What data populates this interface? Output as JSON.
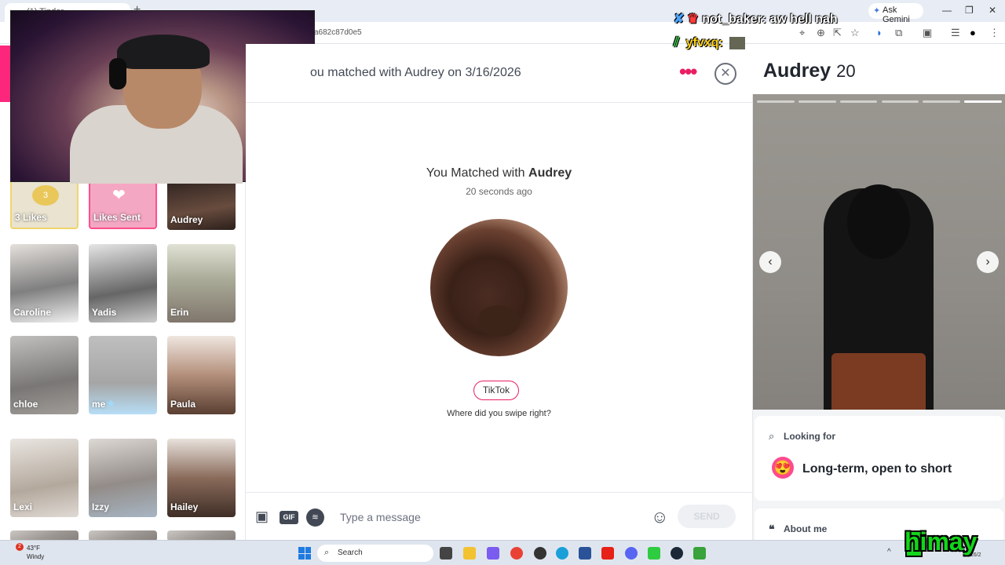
{
  "browser": {
    "tab_title": "(1) Tinder",
    "address": "a682c87d0e5",
    "ask_gemini": "Ask Gemini"
  },
  "left_panel": {
    "likes_count": "3",
    "tiles": [
      {
        "label": "3 Likes"
      },
      {
        "label": "Likes Sent"
      },
      {
        "label": "Audrey"
      },
      {
        "label": "Caroline"
      },
      {
        "label": "Yadis"
      },
      {
        "label": "Erin"
      },
      {
        "label": "chloe"
      },
      {
        "label": "me"
      },
      {
        "label": "Paula"
      },
      {
        "label": "Lexi"
      },
      {
        "label": "Izzy"
      },
      {
        "label": "Hailey"
      }
    ]
  },
  "chat": {
    "header_text": "ou matched with Audrey on 3/16/2026",
    "matched_prefix": "You Matched with ",
    "matched_name": "Audrey",
    "matched_time": "20 seconds ago",
    "platform_pill": "TikTok",
    "swipe_question": "Where did you swipe right?",
    "input_placeholder": "Type a message",
    "send_label": "SEND",
    "gif_label": "GIF"
  },
  "profile": {
    "name": "Audrey",
    "age": "20",
    "looking_for_label": "Looking for",
    "looking_for_value": "Long-term, open to short",
    "looking_for_emoji": "😍",
    "about_label": "About me",
    "photo_count": 6,
    "active_photo": 6
  },
  "stream_chat": [
    {
      "user": "not_baker:",
      "text": "aw hell nah"
    },
    {
      "user": "yfvxq:",
      "text": ""
    }
  ],
  "taskbar": {
    "weather_badge": "2",
    "temperature": "43°F",
    "weather": "Windy",
    "search_label": "Search",
    "date": "3/16/2",
    "streamer": "himay"
  },
  "colors": {
    "tinder_accent": "#fd267d",
    "streamer_green": "#12d61a"
  }
}
